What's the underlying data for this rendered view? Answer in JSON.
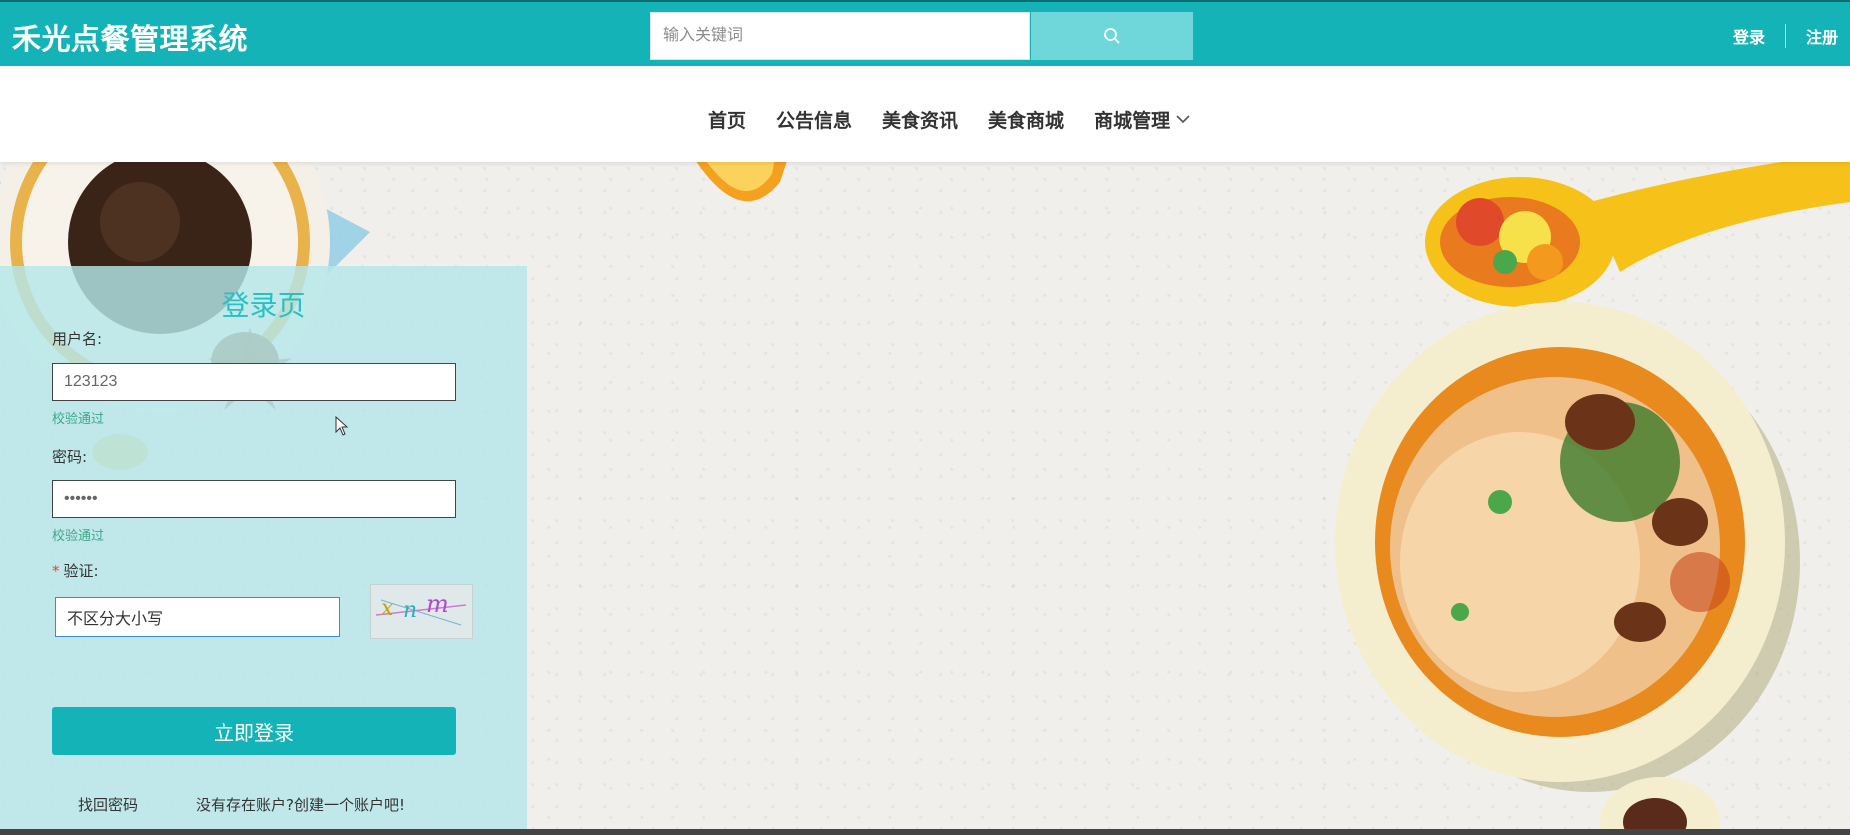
{
  "header": {
    "brand": "禾光点餐管理系统",
    "search_placeholder": "输入关键词",
    "login": "登录",
    "register": "注册"
  },
  "nav": {
    "items": [
      "首页",
      "公告信息",
      "美食资讯",
      "美食商城",
      "商城管理"
    ]
  },
  "login": {
    "title": "登录页",
    "username_label": "用户名:",
    "username_value": "123123",
    "username_valid": "校验通过",
    "password_label": "密码:",
    "password_value": "123456",
    "password_valid": "校验通过",
    "captcha_label": "验证:",
    "captcha_value": "不区分大小写",
    "captcha_code": "xnm",
    "submit": "立即登录",
    "forgot": "找回密码",
    "signup": "没有存在账户?创建一个账户吧!"
  },
  "colors": {
    "primary": "#13b3b8",
    "search_btn": "#6fd6da",
    "panel": "#b4e6e9",
    "valid": "#3ea88a"
  }
}
